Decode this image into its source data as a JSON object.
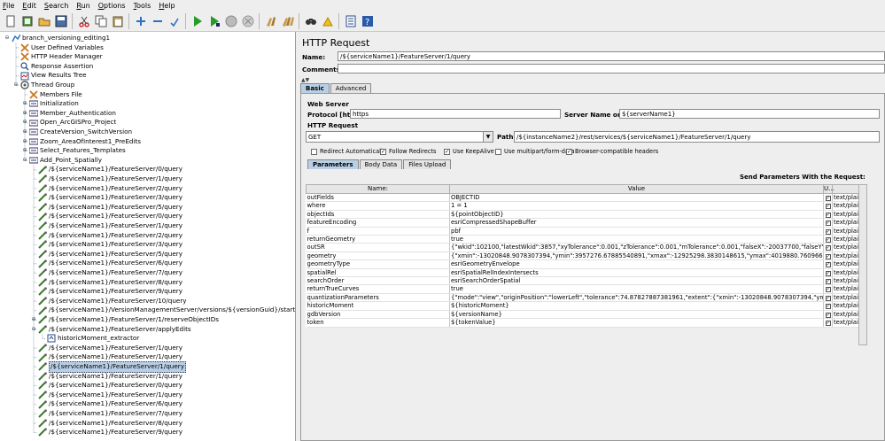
{
  "menu": [
    "File",
    "Edit",
    "Search",
    "Run",
    "Options",
    "Tools",
    "Help"
  ],
  "toolbar": [
    {
      "icon": "new-icon"
    },
    {
      "icon": "templates-icon"
    },
    {
      "icon": "open-icon"
    },
    {
      "icon": "save-icon"
    },
    {
      "sep": true
    },
    {
      "icon": "cut-icon"
    },
    {
      "icon": "copy-icon"
    },
    {
      "icon": "paste-icon"
    },
    {
      "sep": true
    },
    {
      "icon": "expand-icon"
    },
    {
      "icon": "collapse-icon"
    },
    {
      "icon": "toggle-icon"
    },
    {
      "sep": true
    },
    {
      "icon": "start-icon"
    },
    {
      "icon": "start-no-pauses-icon"
    },
    {
      "icon": "stop-icon"
    },
    {
      "icon": "shutdown-icon"
    },
    {
      "sep": true
    },
    {
      "icon": "clear-icon"
    },
    {
      "icon": "clear-all-icon"
    },
    {
      "sep": true
    },
    {
      "icon": "search-icon"
    },
    {
      "icon": "reset-search-icon"
    },
    {
      "sep": true
    },
    {
      "icon": "function-helper-icon"
    },
    {
      "icon": "help-icon"
    }
  ],
  "tree": [
    {
      "level": 0,
      "toggle": "-",
      "icon": "testplan",
      "label": "branch_versioning_editing1"
    },
    {
      "level": 1,
      "icon": "config",
      "label": "User Defined Variables"
    },
    {
      "level": 1,
      "icon": "config",
      "label": "HTTP Header Manager"
    },
    {
      "level": 1,
      "icon": "assertion",
      "label": "Response Assertion"
    },
    {
      "level": 1,
      "icon": "listener",
      "label": "View Results Tree"
    },
    {
      "level": 1,
      "toggle": "-",
      "icon": "threadgroup",
      "label": "Thread Group"
    },
    {
      "level": 2,
      "icon": "config",
      "label": "Members File"
    },
    {
      "level": 2,
      "toggle": "+",
      "icon": "controller",
      "label": "Initialization"
    },
    {
      "level": 2,
      "toggle": "+",
      "icon": "controller",
      "label": "Member_Authentication"
    },
    {
      "level": 2,
      "toggle": "+",
      "icon": "controller",
      "label": "Open_ArcGISPro_Project"
    },
    {
      "level": 2,
      "toggle": "+",
      "icon": "controller",
      "label": "CreateVersion_SwitchVersion"
    },
    {
      "level": 2,
      "toggle": "+",
      "icon": "controller",
      "label": "Zoom_AreaOfInterest1_PreEdits"
    },
    {
      "level": 2,
      "toggle": "+",
      "icon": "controller",
      "label": "Select_Features_Templates"
    },
    {
      "level": 2,
      "toggle": "-",
      "icon": "controller",
      "label": "Add_Point_Spatially"
    },
    {
      "level": 3,
      "icon": "sampler",
      "label": "/${serviceName1}/FeatureServer/0/query"
    },
    {
      "level": 3,
      "icon": "sampler",
      "label": "/${serviceName1}/FeatureServer/1/query"
    },
    {
      "level": 3,
      "icon": "sampler",
      "label": "/${serviceName1}/FeatureServer/2/query"
    },
    {
      "level": 3,
      "icon": "sampler",
      "label": "/${serviceName1}/FeatureServer/3/query"
    },
    {
      "level": 3,
      "icon": "sampler",
      "label": "/${serviceName1}/FeatureServer/5/query"
    },
    {
      "level": 3,
      "icon": "sampler",
      "label": "/${serviceName1}/FeatureServer/0/query"
    },
    {
      "level": 3,
      "icon": "sampler",
      "label": "/${serviceName1}/FeatureServer/1/query"
    },
    {
      "level": 3,
      "icon": "sampler",
      "label": "/${serviceName1}/FeatureServer/2/query"
    },
    {
      "level": 3,
      "icon": "sampler",
      "label": "/${serviceName1}/FeatureServer/3/query"
    },
    {
      "level": 3,
      "icon": "sampler",
      "label": "/${serviceName1}/FeatureServer/5/query"
    },
    {
      "level": 3,
      "icon": "sampler",
      "label": "/${serviceName1}/FeatureServer/6/query"
    },
    {
      "level": 3,
      "icon": "sampler",
      "label": "/${serviceName1}/FeatureServer/7/query"
    },
    {
      "level": 3,
      "icon": "sampler",
      "label": "/${serviceName1}/FeatureServer/8/query"
    },
    {
      "level": 3,
      "icon": "sampler",
      "label": "/${serviceName1}/FeatureServer/9/query"
    },
    {
      "level": 3,
      "icon": "sampler",
      "label": "/${serviceName1}/FeatureServer/10/query"
    },
    {
      "level": 3,
      "icon": "sampler",
      "label": "/${serviceName1}/VersionManagementServer/versions/${versionGuid}/startEditing"
    },
    {
      "level": 3,
      "toggle": "+",
      "icon": "sampler",
      "label": "/${serviceName1}/FeatureServer/1/reserveObjectIDs"
    },
    {
      "level": 3,
      "toggle": "-",
      "icon": "sampler",
      "label": "/${serviceName1}/FeatureServer/applyEdits"
    },
    {
      "level": 4,
      "icon": "extractor",
      "label": "historicMoment_extractor"
    },
    {
      "level": 3,
      "icon": "sampler",
      "label": "/${serviceName1}/FeatureServer/1/query"
    },
    {
      "level": 3,
      "icon": "sampler",
      "label": "/${serviceName1}/FeatureServer/1/query"
    },
    {
      "level": 3,
      "icon": "sampler",
      "label": "/${serviceName1}/FeatureServer/1/query",
      "selected": true
    },
    {
      "level": 3,
      "icon": "sampler",
      "label": "/${serviceName1}/FeatureServer/1/query"
    },
    {
      "level": 3,
      "icon": "sampler",
      "label": "/${serviceName1}/FeatureServer/0/query"
    },
    {
      "level": 3,
      "icon": "sampler",
      "label": "/${serviceName1}/FeatureServer/1/query"
    },
    {
      "level": 3,
      "icon": "sampler",
      "label": "/${serviceName1}/FeatureServer/6/query"
    },
    {
      "level": 3,
      "icon": "sampler",
      "label": "/${serviceName1}/FeatureServer/7/query"
    },
    {
      "level": 3,
      "icon": "sampler",
      "label": "/${serviceName1}/FeatureServer/8/query"
    },
    {
      "level": 3,
      "icon": "sampler",
      "label": "/${serviceName1}/FeatureServer/9/query"
    }
  ],
  "panel": {
    "title": "HTTP Request",
    "name_label": "Name:",
    "name_value": "/${serviceName1}/FeatureServer/1/query",
    "comments_label": "Comments:",
    "comments_value": "",
    "tabs": [
      "Basic",
      "Advanced"
    ],
    "web_server_label": "Web Server",
    "protocol_label": "Protocol [http]:",
    "protocol_value": "https",
    "server_label": "Server Name or IP:",
    "server_value": "${serverName1}",
    "http_request_label": "HTTP Request",
    "method": "GET",
    "path_label": "Path:",
    "path_value": "/${instanceName2}/rest/services/${serviceName1}/FeatureServer/1/query",
    "checkboxes": [
      {
        "label": "Redirect Automatically",
        "checked": false
      },
      {
        "label": "Follow Redirects",
        "checked": true
      },
      {
        "label": "Use KeepAlive",
        "checked": true
      },
      {
        "label": "Use multipart/form-data",
        "checked": false
      },
      {
        "label": "Browser-compatible headers",
        "checked": true
      }
    ],
    "subtabs": [
      "Parameters",
      "Body Data",
      "Files Upload"
    ],
    "send_params_label": "Send Parameters With the Request:",
    "columns": [
      "Name:",
      "Value",
      "U...",
      ""
    ],
    "params": [
      {
        "name": "outFields",
        "value": "OBJECTID",
        "encode": true,
        "type": "text/plain"
      },
      {
        "name": "where",
        "value": "1 = 1",
        "encode": true,
        "type": "text/plain"
      },
      {
        "name": "objectIds",
        "value": "${pointObjectID}",
        "encode": true,
        "type": "text/plain"
      },
      {
        "name": "featureEncoding",
        "value": "esriCompressedShapeBuffer",
        "encode": true,
        "type": "text/plain"
      },
      {
        "name": "f",
        "value": "pbf",
        "encode": true,
        "type": "text/plain"
      },
      {
        "name": "returnGeometry",
        "value": "true",
        "encode": true,
        "type": "text/plain"
      },
      {
        "name": "outSR",
        "value": "{\"wkid\":102100,\"latestWkid\":3857,\"xyTolerance\":0.001,\"zTolerance\":0.001,\"mTolerance\":0.001,\"falseX\":-20037700,\"falseY\":-30241100,...",
        "encode": true,
        "type": "text/plain"
      },
      {
        "name": "geometry",
        "value": "{\"xmin\":-13020848.9078307394,\"ymin\":3957276.67885540891,\"xmax\":-12925298.3830148615,\"ymax\":4019880.7609668076,\"spatial...",
        "encode": true,
        "type": "text/plain"
      },
      {
        "name": "geometryType",
        "value": "esriGeometryEnvelope",
        "encode": true,
        "type": "text/plain"
      },
      {
        "name": "spatialRel",
        "value": "esriSpatialRelIndexIntersects",
        "encode": true,
        "type": "text/plain"
      },
      {
        "name": "searchOrder",
        "value": "esriSearchOrderSpatial",
        "encode": true,
        "type": "text/plain"
      },
      {
        "name": "returnTrueCurves",
        "value": "true",
        "encode": true,
        "type": "text/plain"
      },
      {
        "name": "quantizationParameters",
        "value": "{\"mode\":\"view\",\"originPosition\":\"lowerLeft\",\"tolerance\":74.87827887381961,\"extent\":{\"xmin\":-13020848.9078307394,\"ymin\":3957276.6...",
        "encode": true,
        "type": "text/plain"
      },
      {
        "name": "historicMoment",
        "value": "${historicMoment}",
        "encode": true,
        "type": "text/plain"
      },
      {
        "name": "gdbVersion",
        "value": "${versionName}",
        "encode": true,
        "type": "text/plain"
      },
      {
        "name": "token",
        "value": "${tokenValue}",
        "encode": true,
        "type": "text/plain"
      }
    ]
  }
}
